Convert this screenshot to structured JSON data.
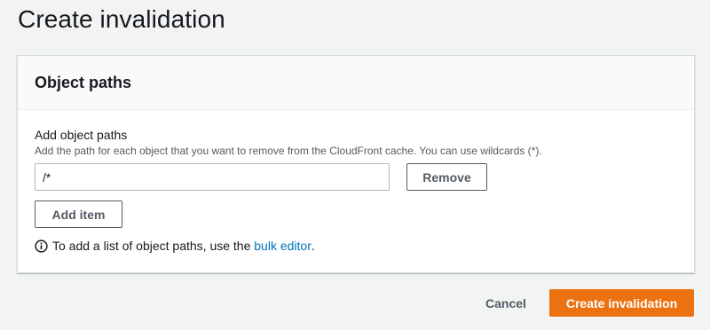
{
  "page": {
    "title": "Create invalidation"
  },
  "panel": {
    "title": "Object paths",
    "field": {
      "label": "Add object paths",
      "description": "Add the path for each object that you want to remove from the CloudFront cache. You can use wildcards (*).",
      "paths": [
        {
          "value": "/*",
          "remove_label": "Remove"
        }
      ]
    },
    "add_item_label": "Add item",
    "info": {
      "icon": "info-icon",
      "prefix": "To add a list of object paths, use the ",
      "link_text": "bulk editor",
      "suffix": "."
    }
  },
  "footer": {
    "cancel_label": "Cancel",
    "primary_label": "Create invalidation"
  },
  "colors": {
    "primary": "#ec7211",
    "link": "#0073bb",
    "background": "#f2f3f3"
  }
}
